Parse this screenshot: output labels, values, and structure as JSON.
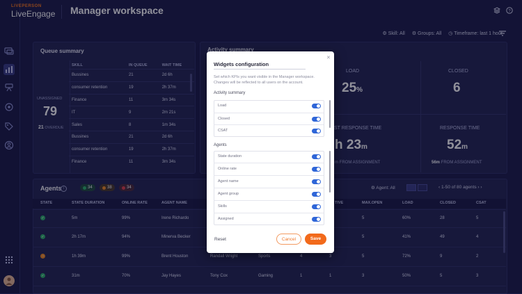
{
  "header": {
    "brand_small": "LIVEPERSON",
    "brand": "LiveEngage",
    "title": "Manager workspace"
  },
  "filters": {
    "skill": "Skill: All",
    "groups": "Groups: All",
    "timeframe": "Timeframe: last 1 hour"
  },
  "queue_summary": {
    "title": "Queue summary",
    "unassigned_label": "UNASSIGNED",
    "unassigned_value": "79",
    "overdue_value": "21",
    "overdue_label": "OVERDUE",
    "columns": [
      "SKILL",
      "IN QUEUE",
      "WAIT TIME"
    ],
    "rows": [
      [
        "Bussines",
        "21",
        "2d 6h"
      ],
      [
        "consumer retention",
        "19",
        "2h 37m"
      ],
      [
        "Finance",
        "11",
        "3m 34s"
      ],
      [
        "IT",
        "9",
        "2m 21s"
      ],
      [
        "Sales",
        "8",
        "1m 34s"
      ],
      [
        "Bussines",
        "21",
        "2d 6h"
      ],
      [
        "consumer retention",
        "19",
        "2h 37m"
      ],
      [
        "Finance",
        "11",
        "3m 34s"
      ]
    ]
  },
  "activity_summary": {
    "title": "Activity summary",
    "load_label": "LOAD",
    "load_value": "25",
    "load_unit": "%",
    "closed_label": "CLOSED",
    "closed_value": "6",
    "frt_label": "ST RESPONSE TIME",
    "frt_value": "h 23",
    "frt_unit": "m",
    "frt_sub": "m FROM ASSIGNMENT",
    "rt_label": "RESPONSE TIME",
    "rt_value": "52",
    "rt_unit": "m",
    "rt_sub_value": "56m",
    "rt_sub_label": "FROM ASSIGNMENT"
  },
  "agents": {
    "title": "Agents",
    "pills": [
      {
        "count": "34",
        "color": "#2fb36b"
      },
      {
        "count": "38",
        "color": "#f08a24"
      },
      {
        "count": "34",
        "color": "#e0404a"
      }
    ],
    "agent_filter": "Agent: All",
    "pagination": "1-50 of 80 agents",
    "columns": [
      "STATE",
      "STATE DURATION",
      "ONLINE RATE",
      "AGENT NAME",
      "",
      "",
      "TIVE",
      "MAX.OPEN",
      "LOAD",
      "CLOSED",
      "CSAT"
    ],
    "rows": [
      {
        "state_color": "#2fb36b",
        "duration": "5m",
        "rate": "99%",
        "name": "Irene Richardo",
        "manager": "",
        "skill": "",
        "c1": "",
        "c2": "",
        "max_open": "5",
        "load": "60%",
        "closed": "28",
        "csat": "5"
      },
      {
        "state_color": "#2fb36b",
        "duration": "2h 17m",
        "rate": "94%",
        "name": "Minerva Becker",
        "manager": "",
        "skill": "",
        "c1": "",
        "c2": "",
        "max_open": "5",
        "load": "41%",
        "closed": "49",
        "csat": "4"
      },
      {
        "state_color": "#f08a24",
        "duration": "1h 39m",
        "rate": "99%",
        "name": "Brent Houston",
        "manager": "Randall Wright",
        "skill": "Sports",
        "c1": "4",
        "c2": "3",
        "max_open": "5",
        "load": "72%",
        "closed": "9",
        "csat": "2"
      },
      {
        "state_color": "#2fb36b",
        "duration": "31m",
        "rate": "70%",
        "name": "Jay Hayes",
        "manager": "Tony Cox",
        "skill": "Gaming",
        "c1": "1",
        "c2": "1",
        "max_open": "3",
        "load": "50%",
        "closed": "5",
        "csat": "3"
      }
    ]
  },
  "modal": {
    "title": "Widgets configuration",
    "description": "Set which KPIs you want visible in the Manager workspace. Changes will be reflected to all users on the account.",
    "section_activity": "Activity summary",
    "activity_items": [
      "Load",
      "Closed",
      "CSAT"
    ],
    "section_agents": "Agents",
    "agent_items": [
      "State duration",
      "Online rate",
      "Agent name",
      "Agent group",
      "Skills",
      "Assigned"
    ],
    "reset": "Reset",
    "cancel": "Cancel",
    "save": "Save"
  }
}
